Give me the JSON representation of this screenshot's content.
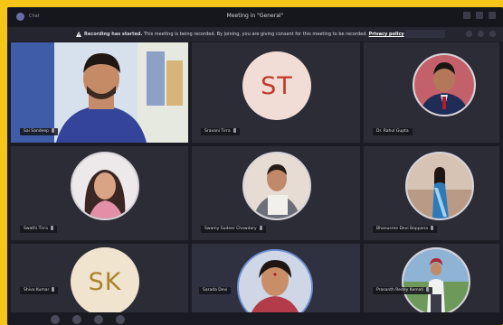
{
  "titlebar": {
    "app_label": "Chat",
    "meeting_title": "Meeting in \"General\""
  },
  "banner": {
    "strong_text": "Recording has started.",
    "body_text": "This meeting is being recorded. By joining, you are giving consent for this meeting to be recorded.",
    "link_text": "Privacy policy"
  },
  "participants": [
    {
      "id": "p1",
      "name": "Sai Sandeep",
      "type": "video"
    },
    {
      "id": "p2",
      "name": "Sravani Tirra",
      "type": "initials",
      "initials": "ST",
      "color": "#c0392b"
    },
    {
      "id": "p3",
      "name": "Dr. Rahul Gupta",
      "type": "photo"
    },
    {
      "id": "p4",
      "name": "Swathi Tirra",
      "type": "photo"
    },
    {
      "id": "p5",
      "name": "Swamy Sudeer Chowdary",
      "type": "photo"
    },
    {
      "id": "p6",
      "name": "Bhanusree Devi Boppana",
      "type": "photo"
    },
    {
      "id": "p7",
      "name": "Shiva Kumar",
      "type": "initials",
      "initials": "SK",
      "color": "#a9822c"
    },
    {
      "id": "p8",
      "name": "Sarada Devi",
      "type": "photo"
    },
    {
      "id": "p9",
      "name": "Prasanth Reddy Komati",
      "type": "photo"
    }
  ]
}
